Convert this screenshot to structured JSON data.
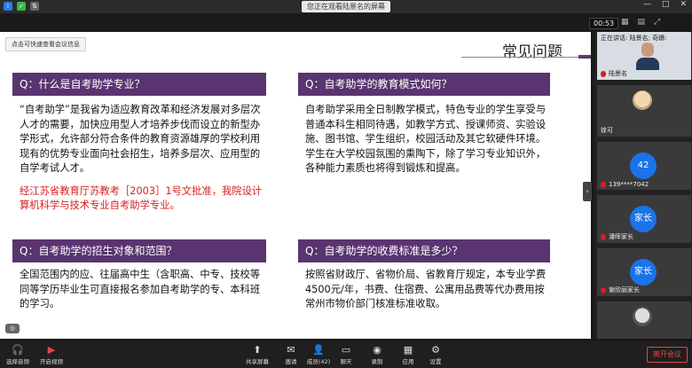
{
  "topbar": {
    "banner": "您正在观看陆景名的屏幕",
    "icons": [
      "i",
      "✓",
      "⇅"
    ],
    "window_controls": [
      "—",
      "□",
      "✕"
    ]
  },
  "meeting": {
    "timer": "00:53",
    "tip_button": "点击可快速查看会议信息",
    "speaking_label": "正在讲话: 陆景名; 奇蹟:"
  },
  "slide": {
    "title": "常见问题",
    "q1": {
      "heading": "Q：什么是自考助学专业？",
      "body": "“自考助学”是我省为适应教育改革和经济发展对多层次人才的需要，加快应用型人才培养步伐而设立的新型办学形式，允许部分符合条件的教育资源雄厚的学校利用现有的优势专业面向社会招生，培养多层次、应用型的自学考试人才。",
      "red": "经江苏省教育厅苏教考［2003］1号文批准，我院设计算机科学与技术专业自考助学专业。"
    },
    "q2": {
      "heading": "Q：自考助学的教育模式如何？",
      "body": "自考助学采用全日制教学模式，特色专业的学生享受与普通本科生相同待遇，如教学方式、授课师资、实验设施、图书馆、学生组织，校园活动及其它软硬件环境。学生在大学校园氛围的熏陶下，除了学习专业知识外，各种能力素质也将得到锻炼和提高。"
    },
    "q3": {
      "heading": "Q：自考助学的招生对象和范围？",
      "body": "全国范围内的应、往届高中生（含职高、中专、技校等同等学历毕业生可直接报名参加自考助学的专、本科班的学习。"
    },
    "q4": {
      "heading": "Q：自考助学的收费标准是多少？",
      "body": "按照省财政厅、省物价局、省教育厅规定，本专业学费4500元/年，书费、住宿费、公寓用品费等代办费用按常州市物价部门核准标准收取。"
    }
  },
  "participants": [
    {
      "name": "陆景名",
      "type": "video"
    },
    {
      "name": "徐可",
      "type": "avatar"
    },
    {
      "name": "139****7042",
      "type": "initial",
      "initial": "42"
    },
    {
      "name": "潘晖家长",
      "type": "initial",
      "initial": "家长"
    },
    {
      "name": "谢欣丽家长",
      "type": "initial",
      "initial": "家长"
    }
  ],
  "toolbar": {
    "audio": "选择音频",
    "video": "开启视频",
    "share": "共享屏幕",
    "invite": "邀请",
    "members": "成员(42)",
    "chat": "聊天",
    "record": "录制",
    "apps": "应用",
    "settings": "设置",
    "leave": "离开会议"
  },
  "colors": {
    "question_bar": "#5a3470",
    "red_text": "#d62020",
    "leave": "#e54545",
    "avatar_blue": "#1a73e8"
  }
}
